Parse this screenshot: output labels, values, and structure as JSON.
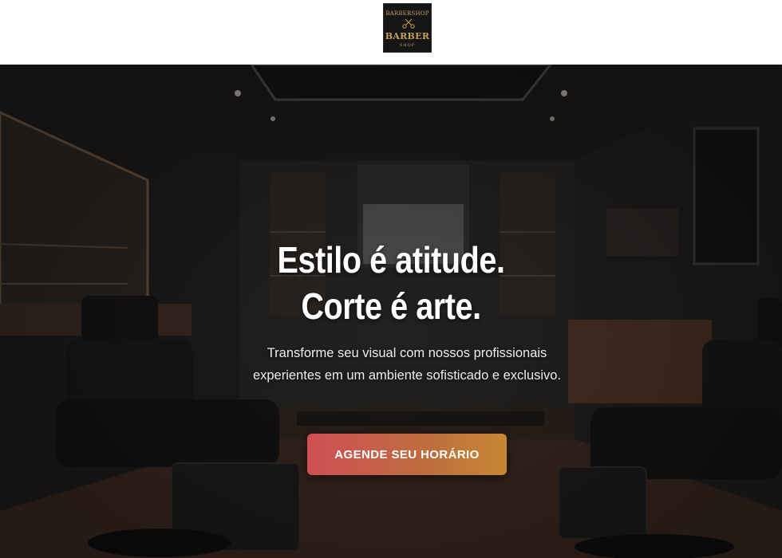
{
  "header": {
    "logo": {
      "arc_text": "BARBERSHOP",
      "main_text": "BARBER",
      "sub_text": "SHOP",
      "icon": "scissors-razor-icon",
      "color": "#c7a25a"
    }
  },
  "hero": {
    "title_line1": "Estilo é atitude.",
    "title_line2": "Corte é arte.",
    "subtitle": "Transforme seu visual com nossos profissionais experientes em um ambiente sofisticado e exclusivo.",
    "cta_label": "AGENDE SEU HORÁRIO",
    "cta_colors": [
      "#cf4f55",
      "#c88732"
    ],
    "background": "barbershop-interior-photo"
  }
}
